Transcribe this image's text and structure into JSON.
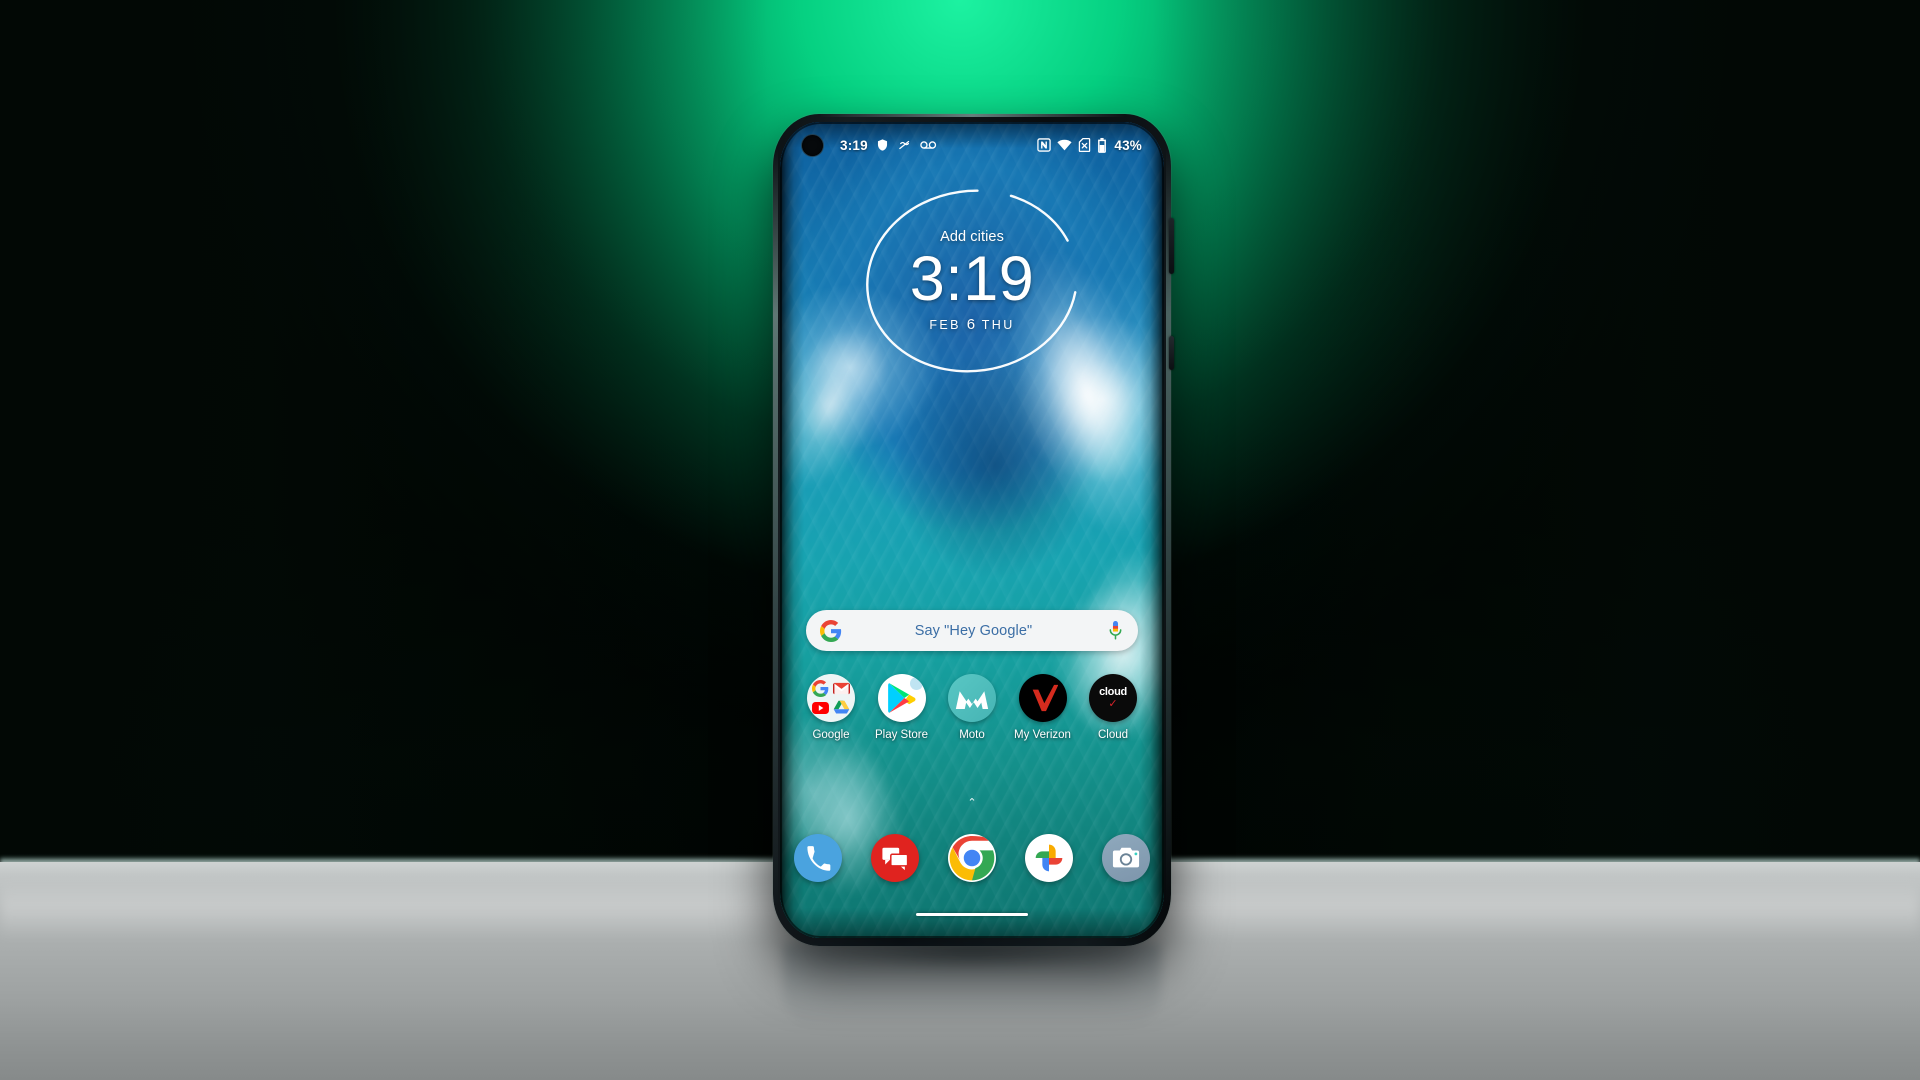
{
  "scene": {
    "background_center_color": "#06e08c",
    "background_edge_color": "#030a06",
    "table_color": "#a9adad",
    "device_label": "smartphone-motorola-edge-plus"
  },
  "statusbar": {
    "time": "3:19",
    "battery_percent": "43%",
    "left_icons": [
      "punch-hole-camera",
      "shield-icon",
      "vibrate-icon",
      "voicemail-icon"
    ],
    "right_icons": [
      "nfc-icon",
      "wifi-icon",
      "no-sim-icon",
      "battery-icon"
    ]
  },
  "clock_widget": {
    "add_cities_label": "Add cities",
    "time": "3:19",
    "date_month": "FEB",
    "date_day": "6",
    "date_weekday": "THU"
  },
  "search": {
    "placeholder": "Say \"Hey Google\"",
    "logo": "google-g-logo",
    "mic": "microphone-icon"
  },
  "apps": [
    {
      "label": "Google",
      "icon": "google-folder-icon"
    },
    {
      "label": "Play Store",
      "icon": "play-store-icon"
    },
    {
      "label": "Moto",
      "icon": "moto-icon"
    },
    {
      "label": "My Verizon",
      "icon": "verizon-checkmark-icon"
    },
    {
      "label": "Cloud",
      "icon": "cloud-icon",
      "badge_text": "cloud",
      "badge_check": "✓"
    }
  ],
  "page_indicator": {
    "glyph": "⌃",
    "name": "app-drawer-chevron"
  },
  "dock": [
    {
      "label": "Phone",
      "icon": "phone-icon"
    },
    {
      "label": "Messages",
      "icon": "messages-icon"
    },
    {
      "label": "Chrome",
      "icon": "chrome-icon"
    },
    {
      "label": "Google Photos",
      "icon": "photos-icon"
    },
    {
      "label": "Camera",
      "icon": "camera-icon"
    }
  ],
  "navigation": {
    "home_gesture_bar": "home-gesture-bar"
  },
  "hardware": {
    "volume_rocker": "volume-rocker",
    "power_button": "power-button"
  }
}
